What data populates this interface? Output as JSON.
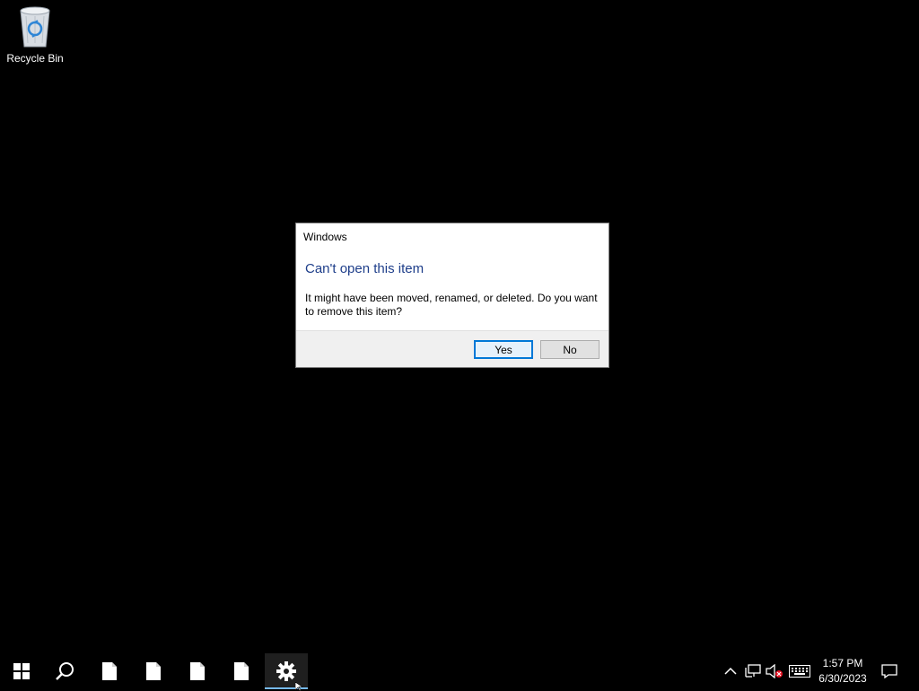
{
  "desktop": {
    "icons": [
      {
        "label": "Recycle Bin",
        "icon": "recycle-bin-icon"
      }
    ]
  },
  "dialog": {
    "title": "Windows",
    "heading": "Can't open this item",
    "message": "It might have been moved, renamed, or deleted. Do you want to remove this item?",
    "yes_label": "Yes",
    "no_label": "No",
    "heading_color": "#1e3e8a",
    "accent_color": "#0078d7"
  },
  "taskbar": {
    "start_icon": "windows-logo-icon",
    "search_icon": "search-icon",
    "pinned": [
      {
        "icon": "file-icon"
      },
      {
        "icon": "file-icon"
      },
      {
        "icon": "file-icon"
      },
      {
        "icon": "file-icon"
      },
      {
        "icon": "settings-gear-icon",
        "active": true
      }
    ],
    "tray": {
      "chevron_icon": "chevron-up-icon",
      "network_icon": "network-icon",
      "volume_icon": "volume-muted-icon",
      "keyboard_icon": "keyboard-icon",
      "notification_icon": "action-center-icon"
    },
    "clock": {
      "time": "1:57 PM",
      "date": "6/30/2023"
    },
    "active_indicator_color": "#76b9ed"
  }
}
